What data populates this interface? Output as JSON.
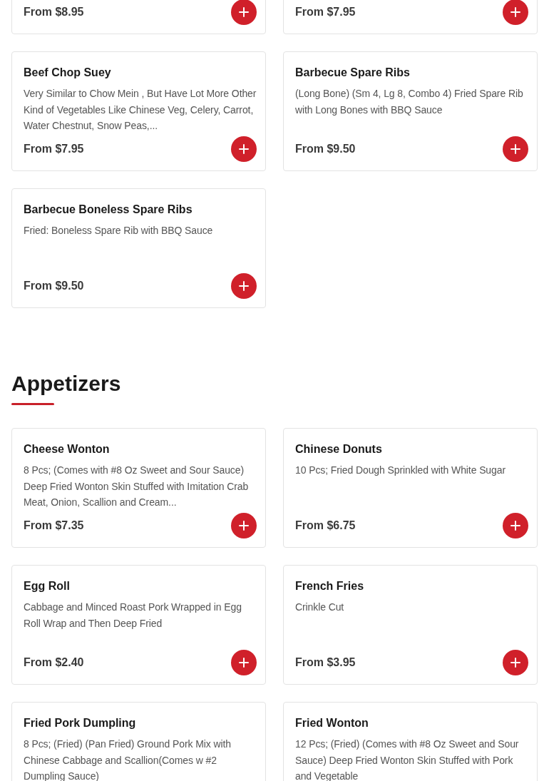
{
  "partial_items": [
    {
      "price": "From $8.95"
    },
    {
      "price": "From $7.95"
    }
  ],
  "items": [
    {
      "name": "Beef Chop Suey",
      "description": "Very Similar to Chow Mein , But Have Lot More Other Kind of Vegetables Like Chinese Veg, Celery, Carrot, Water Chestnut, Snow Peas,...",
      "price": "From $7.95"
    },
    {
      "name": "Barbecue Spare Ribs",
      "description": "(Long Bone) (Sm 4, Lg 8, Combo 4) Fried Spare Rib with Long Bones with BBQ Sauce",
      "price": "From $9.50"
    },
    {
      "name": "Barbecue Boneless Spare Ribs",
      "description": "Fried: Boneless Spare Rib with BBQ Sauce",
      "price": "From $9.50"
    }
  ],
  "sections": [
    {
      "title": "Appetizers",
      "items": [
        {
          "name": "Cheese Wonton",
          "description": "8 Pcs; (Comes with #8 Oz Sweet and Sour Sauce) Deep Fried Wonton Skin Stuffed with Imitation Crab Meat, Onion, Scallion and Cream...",
          "price": "From $7.35"
        },
        {
          "name": "Chinese Donuts",
          "description": "10 Pcs; Fried Dough Sprinkled with White Sugar",
          "price": "From $6.75"
        },
        {
          "name": "Egg Roll",
          "description": "Cabbage and Minced Roast Pork Wrapped in Egg Roll Wrap and Then Deep Fried",
          "price": "From $2.40"
        },
        {
          "name": "French Fries",
          "description": "Crinkle Cut",
          "price": "From $3.95"
        },
        {
          "name": "Fried Pork Dumpling",
          "description": "8 Pcs; (Fried) (Pan Fried) Ground Pork Mix with Chinese Cabbage and Scallion(Comes w #2 Dumpling Sauce)"
        },
        {
          "name": "Fried Wonton",
          "description": "12 Pcs; (Fried) (Comes with #8 Oz Sweet and Sour Sauce) Deep Fried Wonton Skin Stuffed with Pork and Vegetable"
        }
      ]
    }
  ]
}
